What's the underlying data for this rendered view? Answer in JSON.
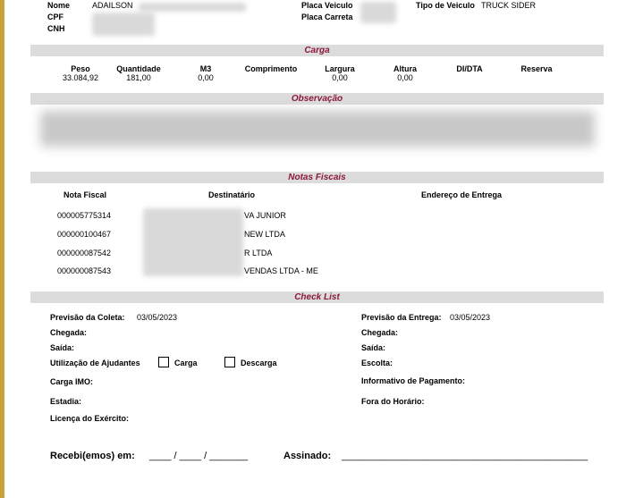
{
  "header": {
    "nome_label": "Nome",
    "nome_value": "ADAILSON",
    "cpf_label": "CPF",
    "cnh_label": "CNH",
    "placa_veiculo_label": "Placa Veiculo",
    "placa_carreta_label": "Placa Carreta",
    "tipo_veiculo_label": "Tipo de Veiculo",
    "tipo_veiculo_value": "TRUCK SIDER"
  },
  "carga": {
    "title": "Carga",
    "columns": [
      "Peso",
      "Quantidade",
      "M3",
      "Comprimento",
      "Largura",
      "Altura",
      "DI/DTA",
      "Reserva"
    ],
    "values": [
      "33.084,92",
      "181,00",
      "0,00",
      "",
      "0,00",
      "0,00",
      "",
      ""
    ]
  },
  "observacao": {
    "title": "Observação"
  },
  "notas": {
    "title": "Notas Fiscais",
    "columns": [
      "Nota Fiscal",
      "Destinatário",
      "Endereço de Entrega"
    ],
    "rows": [
      {
        "nota": "000005775314",
        "dest": "VA JUNIOR"
      },
      {
        "nota": "000000100467",
        "dest": "NEW LTDA"
      },
      {
        "nota": "000000087542",
        "dest": "R LTDA"
      },
      {
        "nota": "000000087543",
        "dest": "VENDAS LTDA - ME"
      }
    ]
  },
  "checklist": {
    "title": "Check List",
    "previsao_coleta_label": "Previsão da Coleta:",
    "previsao_coleta_value": "03/05/2023",
    "previsao_entrega_label": "Previsão da Entrega:",
    "previsao_entrega_value": "03/05/2023",
    "chegada_label": "Chegada:",
    "saida_label": "Saída:",
    "ajudantes_label": "Utilização de Ajudantes",
    "carga_option": "Carga",
    "descarga_option": "Descarga",
    "escolta_label": "Escolta:",
    "carga_imo_label": "Carga IMO:",
    "informativo_label": "Informativo de Pagamento:",
    "estadia_label": "Estadia:",
    "fora_horario_label": "Fora do Horário:",
    "licenca_label": "Licença do Exército:"
  },
  "signature": {
    "recebi_label": "Recebi(emos) em:",
    "date_blank": "____ / ____ / _______",
    "assinado_label": "Assinado:",
    "sign_line": "_____________________________________________"
  }
}
